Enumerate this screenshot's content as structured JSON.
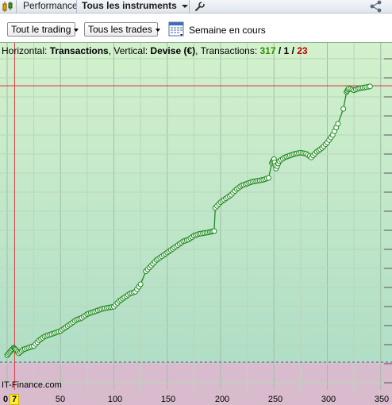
{
  "tabs": {
    "performance_label": "Performance",
    "instruments_label": "Tous les instruments"
  },
  "filters": {
    "trading_label": "Tout le trading",
    "trades_label": "Tous les trades",
    "period_label": "Semaine en cours"
  },
  "chart_info": {
    "horizontal_prefix": "Horizontal: ",
    "horizontal_value": "Transactions",
    "vertical_prefix": ", Vertical: ",
    "vertical_value": "Devise (€)",
    "transactions_prefix": ", Transactions: ",
    "count_total": "317",
    "sep1": " / ",
    "count_neutral": "1",
    "sep2": " / ",
    "count_losing": "23"
  },
  "watermark": "IT-Finance.com",
  "cursor_x_label": "7",
  "colors": {
    "equity_line": "#1e8a1e",
    "marker_fill": "#ffffff",
    "crosshair": "#e0363f",
    "negative_zone": "#d8bccd"
  },
  "chart_data": {
    "type": "line",
    "x_ticks": [
      "0",
      "50",
      "100",
      "150",
      "200",
      "250",
      "300",
      "350"
    ],
    "xlim": [
      0,
      350
    ],
    "grid": true,
    "y_tick_labels_shown": false,
    "cursor_x": 7,
    "series": [
      {
        "points_note": "cumulative P&L per transaction, relative units (0 = baseline)",
        "x": [
          0,
          3,
          6,
          8,
          11,
          15,
          20,
          25,
          30,
          35,
          40,
          45,
          50,
          55,
          60,
          65,
          70,
          75,
          80,
          85,
          90,
          95,
          100,
          105,
          110,
          115,
          120,
          125,
          130,
          135,
          140,
          145,
          150,
          155,
          160,
          165,
          170,
          175,
          180,
          185,
          190,
          194,
          195,
          200,
          205,
          210,
          215,
          220,
          225,
          230,
          235,
          240,
          245,
          248,
          250,
          252,
          255,
          260,
          265,
          270,
          275,
          280,
          285,
          290,
          295,
          300,
          305,
          310,
          315,
          318,
          320,
          325,
          330,
          335,
          340
        ],
        "y": [
          2,
          4,
          6,
          5,
          3,
          5,
          6,
          7,
          10,
          12,
          13,
          14,
          15,
          17,
          19,
          21,
          22,
          24,
          25,
          26,
          27,
          27.5,
          28,
          31,
          33,
          35,
          36,
          40,
          47,
          50,
          53,
          55,
          57,
          59,
          61,
          63,
          64,
          66,
          67,
          67.5,
          68,
          68.5,
          81,
          84,
          86,
          88,
          91,
          93,
          94,
          95,
          95.5,
          96,
          97,
          105,
          107,
          102,
          106,
          108,
          109,
          110,
          110.5,
          110,
          108,
          111,
          113,
          116,
          120,
          126,
          134,
          143,
          145,
          144,
          145,
          145.5,
          146
        ]
      }
    ]
  }
}
